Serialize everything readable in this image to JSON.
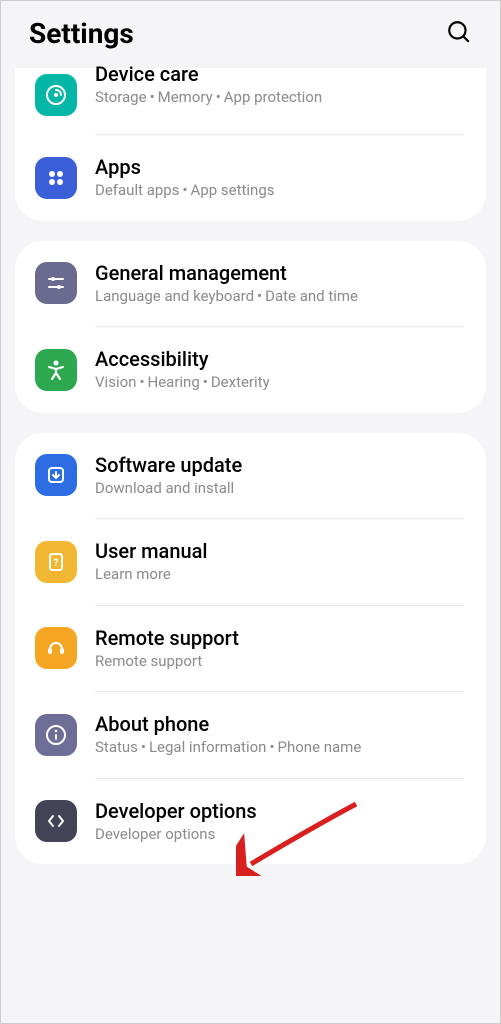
{
  "header": {
    "title": "Settings"
  },
  "sections": [
    {
      "items": [
        {
          "title": "Device care",
          "sub_parts": [
            "Storage",
            "Memory",
            "App protection"
          ]
        },
        {
          "title": "Apps",
          "sub_parts": [
            "Default apps",
            "App settings"
          ]
        }
      ]
    },
    {
      "items": [
        {
          "title": "General management",
          "sub_parts": [
            "Language and keyboard",
            "Date and time"
          ]
        },
        {
          "title": "Accessibility",
          "sub_parts": [
            "Vision",
            "Hearing",
            "Dexterity"
          ]
        }
      ]
    },
    {
      "items": [
        {
          "title": "Software update",
          "sub_parts": [
            "Download and install"
          ]
        },
        {
          "title": "User manual",
          "sub_parts": [
            "Learn more"
          ]
        },
        {
          "title": "Remote support",
          "sub_parts": [
            "Remote support"
          ]
        },
        {
          "title": "About phone",
          "sub_parts": [
            "Status",
            "Legal information",
            "Phone name"
          ]
        },
        {
          "title": "Developer options",
          "sub_parts": [
            "Developer options"
          ]
        }
      ]
    }
  ]
}
